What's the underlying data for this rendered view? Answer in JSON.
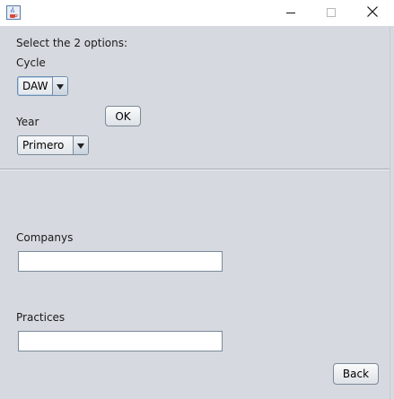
{
  "window": {
    "title": "",
    "icons": {
      "app": "java-coffee-cup-icon",
      "minimize": "minimize-icon",
      "maximize": "maximize-icon",
      "close": "close-icon"
    }
  },
  "form": {
    "instruction": "Select the 2 options:",
    "cycle": {
      "label": "Cycle",
      "selected": "DAW"
    },
    "year": {
      "label": "Year",
      "selected": "Primero"
    },
    "ok_label": "OK",
    "companys": {
      "label": "Companys",
      "value": ""
    },
    "practices": {
      "label": "Practices",
      "value": ""
    },
    "back_label": "Back"
  },
  "colors": {
    "background": "#d6d9df",
    "titlebar": "#ffffff",
    "border": "#7a8a99"
  }
}
